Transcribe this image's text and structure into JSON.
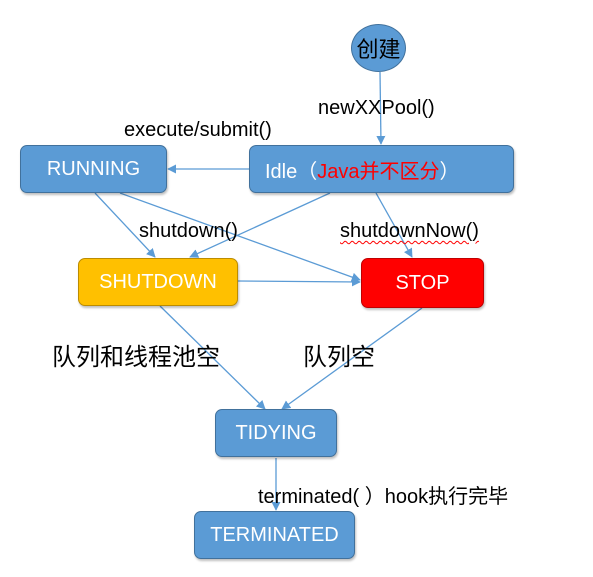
{
  "colors": {
    "blue": "#5b9bd5",
    "orange": "#ffc000",
    "red": "#ff0000",
    "edge": "#5b9bd5"
  },
  "nodes": {
    "create": "创建",
    "running": "RUNNING",
    "idle": "Idle（",
    "idle_note": "Java并不区分",
    "idle_close": "）",
    "shutdown": "SHUTDOWN",
    "stop": "STOP",
    "tidying": "TIDYING",
    "terminated": "TERMINATED"
  },
  "edges": {
    "new_pool": "newXXPool()",
    "execute_submit": "execute/submit()",
    "shutdown_call": "shutdown()",
    "shutdown_now_call": "shutdownNow()",
    "queue_and_pool_empty": "队列和线程池空",
    "queue_empty": "队列空",
    "terminated_hook": "terminated( ）hook执行完毕"
  }
}
